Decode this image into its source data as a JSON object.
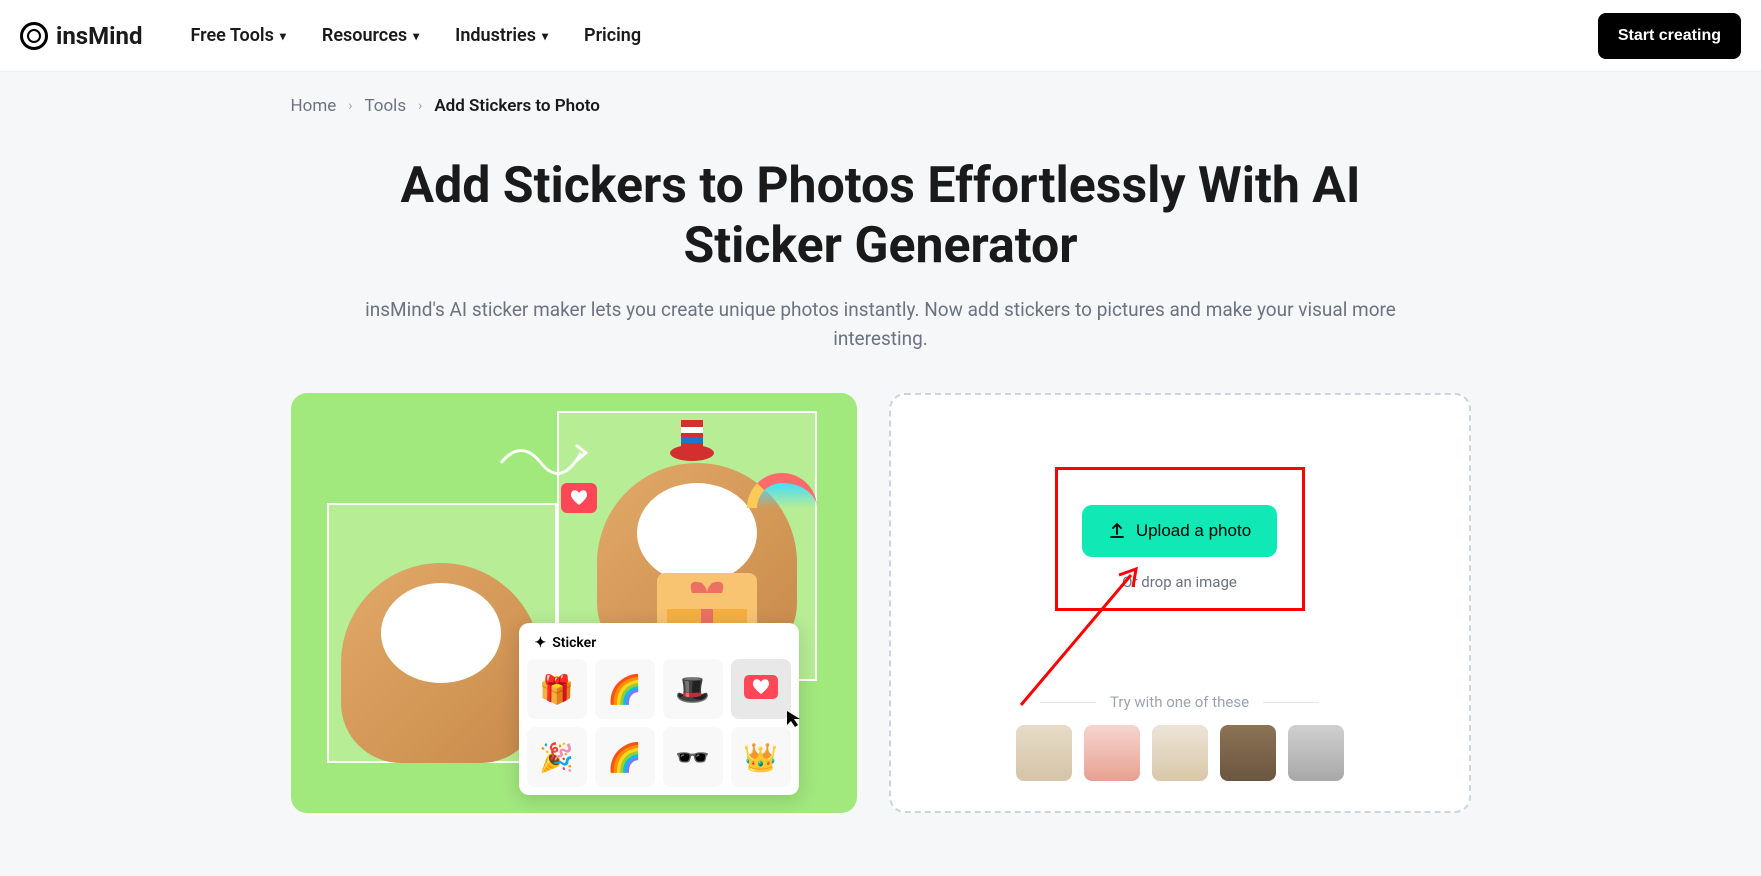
{
  "header": {
    "logo_text": "insMind",
    "nav": [
      {
        "label": "Free Tools",
        "dropdown": true
      },
      {
        "label": "Resources",
        "dropdown": true
      },
      {
        "label": "Industries",
        "dropdown": true
      },
      {
        "label": "Pricing",
        "dropdown": false
      }
    ],
    "cta_label": "Start creating"
  },
  "breadcrumb": {
    "home": "Home",
    "tools": "Tools",
    "current": "Add Stickers to Photo"
  },
  "hero": {
    "title": "Add Stickers to Photos Effortlessly With AI Sticker Generator",
    "subtitle": "insMind's AI sticker maker lets you create unique photos instantly. Now add stickers to pictures and make your visual more interesting."
  },
  "demo": {
    "popup_label": "Sticker",
    "sticker_icons": [
      "🎁",
      "🌈",
      "🎩",
      "❤️",
      "🎉",
      "🌈",
      "🕶️",
      "👑"
    ]
  },
  "upload": {
    "button_label": "Upload a photo",
    "drop_text": "Or drop an image",
    "samples_label": "Try with one of these"
  },
  "colors": {
    "accent_green": "#a1e87d",
    "accent_teal": "#10e8b5",
    "highlight_red": "#ff0000"
  }
}
